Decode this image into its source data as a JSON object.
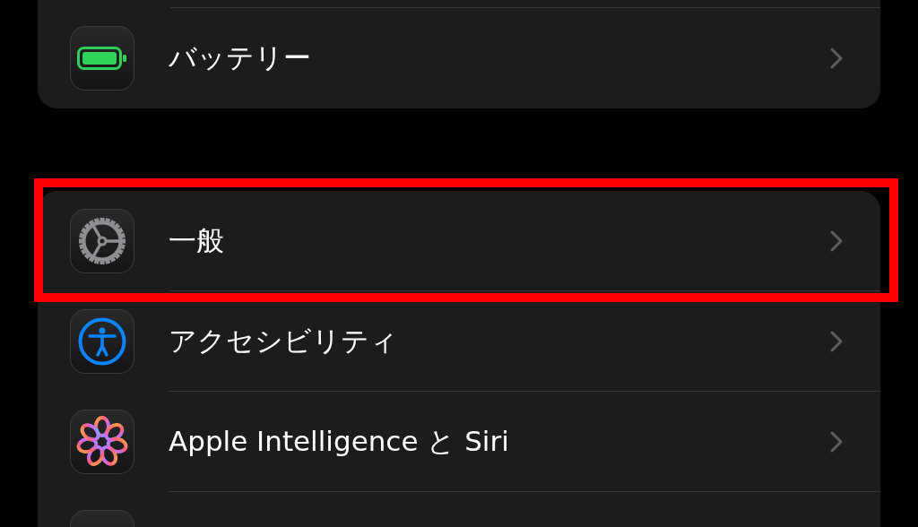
{
  "groups": [
    {
      "rows": [
        {
          "kind": "battery",
          "label": "バッテリー",
          "highlighted": false
        }
      ]
    },
    {
      "rows": [
        {
          "kind": "gear",
          "label": "一般",
          "highlighted": true
        },
        {
          "kind": "accessibility",
          "label": "アクセシビリティ",
          "highlighted": false
        },
        {
          "kind": "intelligence",
          "label": "Apple Intelligence と Siri",
          "highlighted": false
        },
        {
          "kind": "partial",
          "highlighted": false
        }
      ]
    }
  ]
}
